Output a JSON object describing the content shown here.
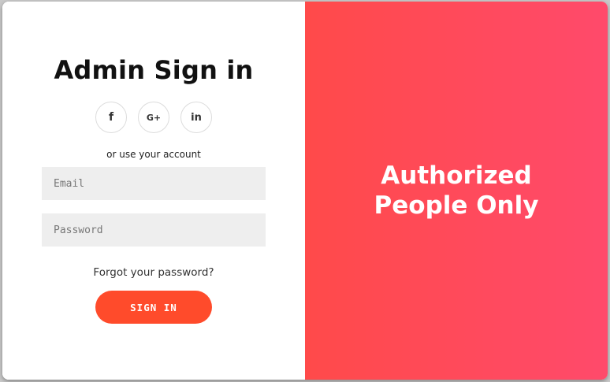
{
  "form": {
    "title": "Admin Sign in",
    "social": [
      {
        "icon": "facebook-icon",
        "glyph": "f"
      },
      {
        "icon": "google-plus-icon",
        "glyph": "G+"
      },
      {
        "icon": "linkedin-icon",
        "glyph": "in"
      }
    ],
    "alt_text": "or use your account",
    "email_placeholder": "Email",
    "password_placeholder": "Password",
    "forgot_label": "Forgot your password?",
    "signin_label": "SIGN IN"
  },
  "overlay": {
    "text": "Authorized People Only"
  },
  "colors": {
    "accent": "#ff4b2b",
    "overlay_start": "#ff4a4a",
    "overlay_end": "#ff4a6b"
  }
}
